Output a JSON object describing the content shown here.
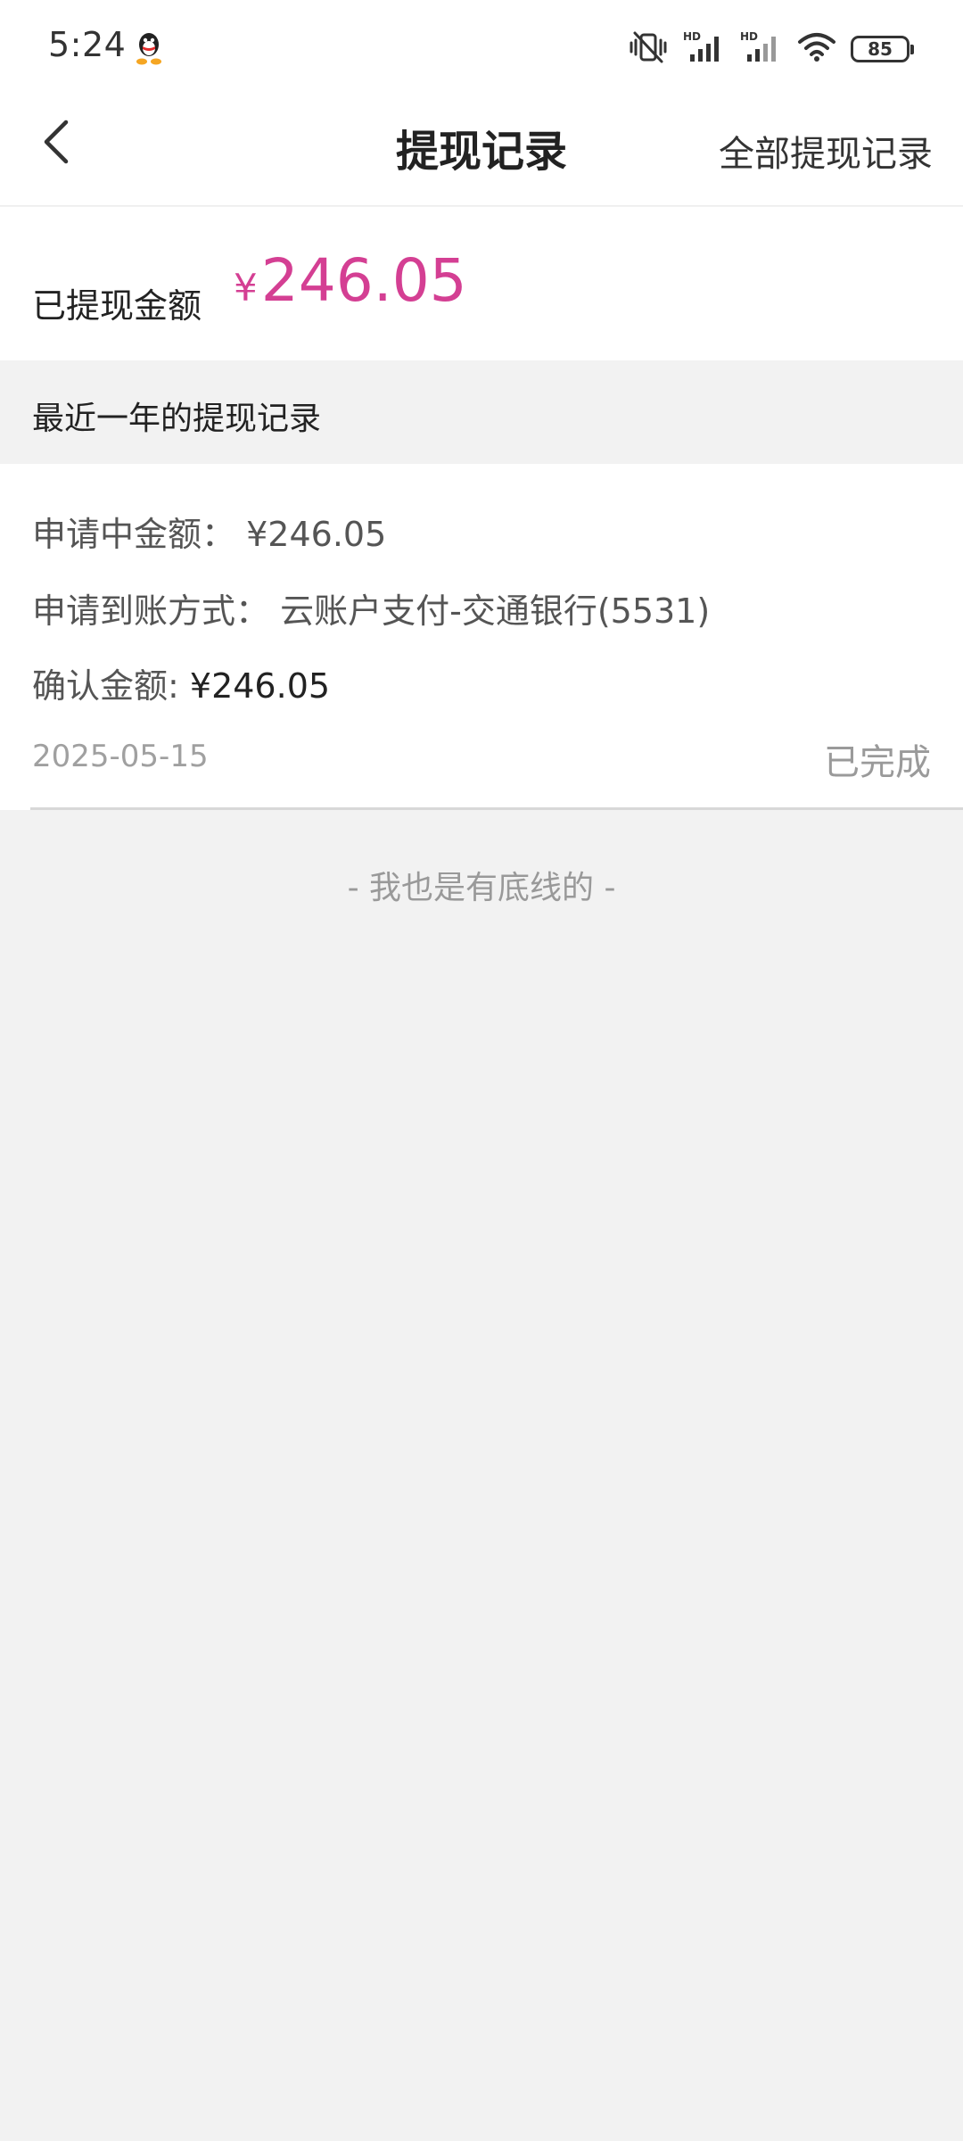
{
  "status_bar": {
    "time": "5:24",
    "battery": "85",
    "icons": [
      "qq-icon",
      "vibrate-off-icon",
      "hd-signal-icon",
      "hd-signal-icon",
      "wifi-icon",
      "battery-icon"
    ]
  },
  "nav": {
    "back_icon": "chevron-left-icon",
    "title": "提现记录",
    "action_label": "全部提现记录"
  },
  "summary": {
    "label": "已提现金额",
    "currency": "¥",
    "amount": "246.05",
    "accent_color": "#d43f93"
  },
  "section": {
    "title": "最近一年的提现记录"
  },
  "record": {
    "pending_label": "申请中金额：",
    "pending_value": "¥246.05",
    "method_label": "申请到账方式：",
    "method_value": "云账户支付-交通银行(5531)",
    "confirmed_label": "确认金额:",
    "confirmed_value": "¥246.05",
    "date": "2025-05-15",
    "status": "已完成"
  },
  "footer": {
    "note": "- 我也是有底线的 -"
  }
}
